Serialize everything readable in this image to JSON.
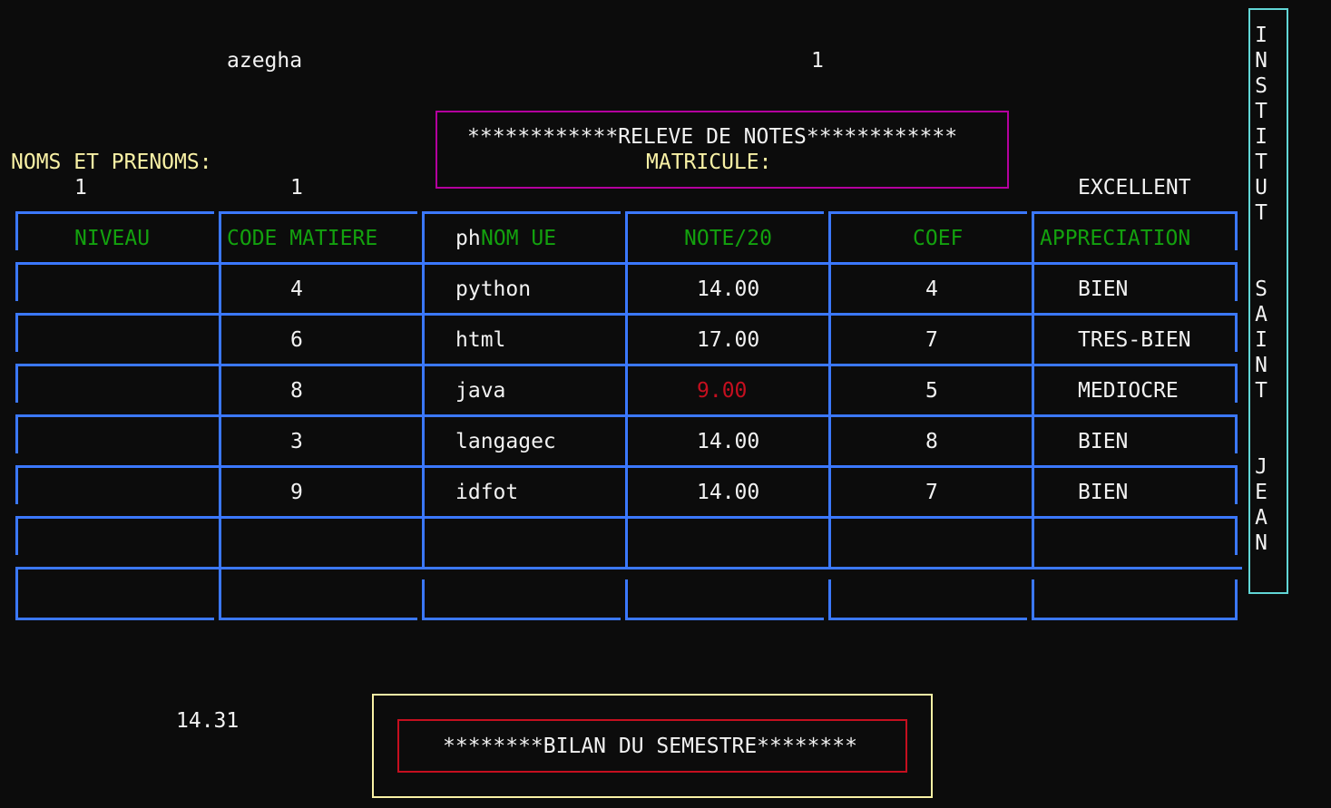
{
  "header": {
    "username": "azegha",
    "count": "1",
    "title": "************RELEVE DE NOTES************",
    "matricule_label": "MATRICULE:",
    "names_label": "NOMS ET PRENOMS:",
    "niveau_value": "1",
    "code_value": "1",
    "mention": "EXCELLENT"
  },
  "side_banner": "I\nN\nS\nT\nI\nT\nU\nT\n\n\nS\nA\nI\nN\nT\n\n\nJ\nE\nA\nN",
  "table": {
    "columns": {
      "niveau": "NIVEAU",
      "code": "CODE MATIERE",
      "nom_prefix": "ph",
      "nom": "NOM UE",
      "note": "NOTE/20",
      "coef": "COEF",
      "appreciation": "APPRECIATION"
    },
    "rows": [
      {
        "code": "4",
        "nom": "python",
        "note": "14.00",
        "coef": "4",
        "appreciation": "BIEN"
      },
      {
        "code": "6",
        "nom": "html",
        "note": "17.00",
        "coef": "7",
        "appreciation": "TRES-BIEN"
      },
      {
        "code": "8",
        "nom": "java",
        "note": "9.00",
        "coef": "5",
        "appreciation": "MEDIOCRE"
      },
      {
        "code": "3",
        "nom": "langagec",
        "note": "14.00",
        "coef": "8",
        "appreciation": "BIEN"
      },
      {
        "code": "9",
        "nom": "idfot",
        "note": "14.00",
        "coef": "7",
        "appreciation": "BIEN"
      }
    ]
  },
  "footer": {
    "average": "14.31",
    "bilan_title": "********BILAN DU SEMESTRE********"
  },
  "colors": {
    "background": "#0c0c0c",
    "text": "#f2f2f2",
    "label_yellow": "#f9f1a5",
    "header_green": "#13a10e",
    "table_blue": "#3b78ff",
    "failing_red": "#c50f1f",
    "title_box_magenta": "#b4009e",
    "banner_cyan": "#61d6d6"
  }
}
